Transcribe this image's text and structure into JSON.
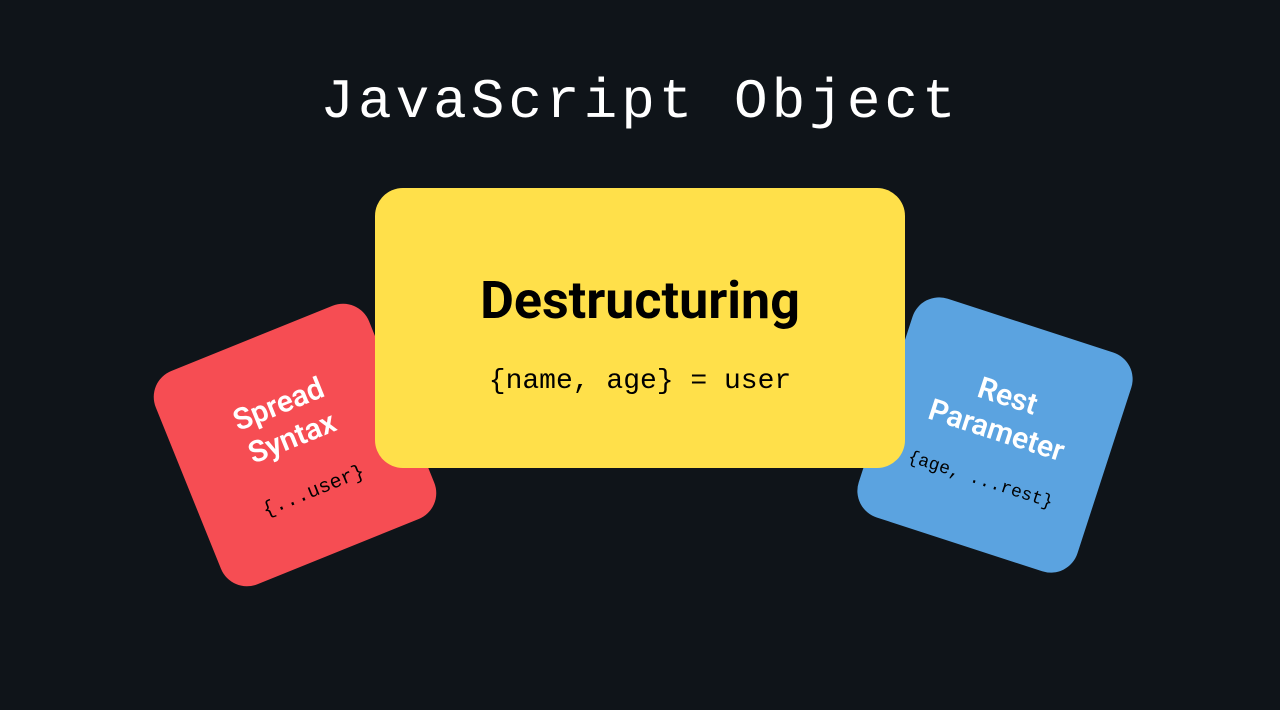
{
  "title": "JavaScript Object",
  "cards": {
    "destructuring": {
      "title": "Destructuring",
      "code": "{name, age} = user",
      "color": "#ffe04a"
    },
    "spread": {
      "title_line1": "Spread",
      "title_line2": "Syntax",
      "code": "{...user}",
      "color": "#f64d53"
    },
    "rest": {
      "title_line1": "Rest",
      "title_line2": "Parameter",
      "code": "{age, ...rest}",
      "color": "#5ba3e0"
    }
  }
}
